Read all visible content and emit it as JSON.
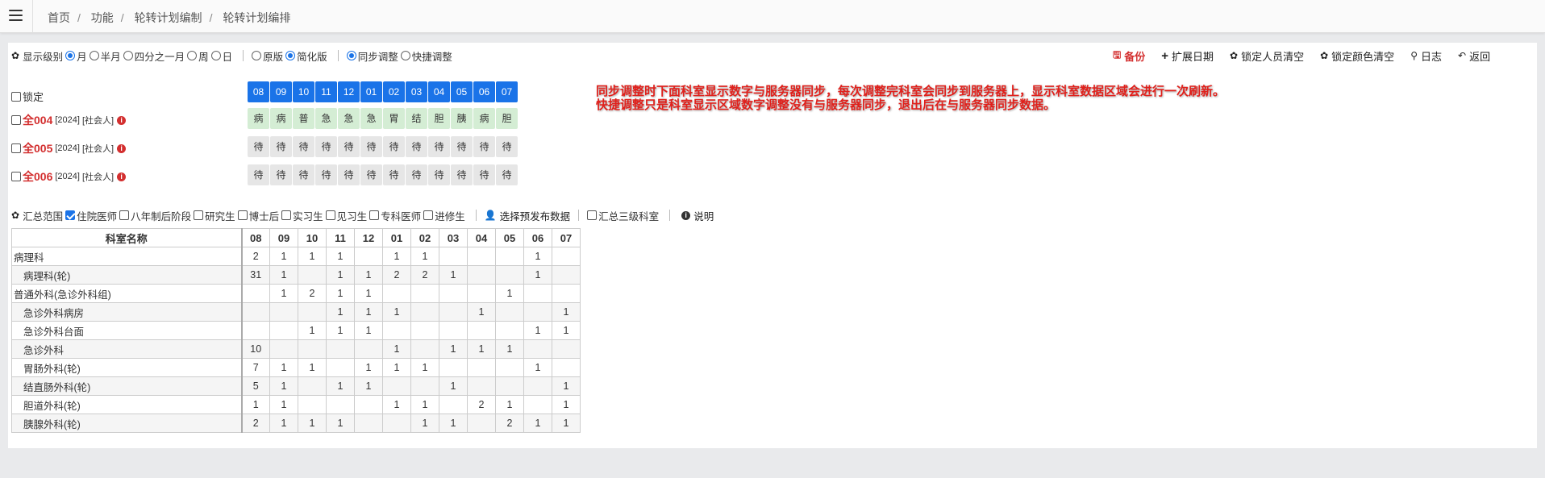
{
  "topbar": {
    "breadcrumb": [
      "首页",
      "功能",
      "轮转计划编制",
      "轮转计划编排"
    ]
  },
  "options": {
    "level_label": "显示级别",
    "levels": [
      {
        "label": "月",
        "checked": true
      },
      {
        "label": "半月",
        "checked": false
      },
      {
        "label": "四分之一月",
        "checked": false
      },
      {
        "label": "周",
        "checked": false
      },
      {
        "label": "日",
        "checked": false
      }
    ],
    "versions": [
      {
        "label": "原版",
        "checked": false
      },
      {
        "label": "简化版",
        "checked": true
      }
    ],
    "adjust": [
      {
        "label": "同步调整",
        "checked": true
      },
      {
        "label": "快捷调整",
        "checked": false
      }
    ]
  },
  "toolbar": {
    "backup": "备份",
    "extend_date": "扩展日期",
    "clear_people": "锁定人员清空",
    "clear_color": "锁定颜色清空",
    "log": "日志",
    "back": "返回"
  },
  "lock_label": "锁定",
  "months": [
    "08",
    "09",
    "10",
    "11",
    "12",
    "01",
    "02",
    "03",
    "04",
    "05",
    "06",
    "07"
  ],
  "people": [
    {
      "id": "全004",
      "year": "[2024]",
      "type": "[社会人]",
      "cells": [
        "病",
        "病",
        "普",
        "急",
        "急",
        "急",
        "胃",
        "结",
        "胆",
        "胰",
        "病",
        "胆"
      ],
      "style": "green"
    },
    {
      "id": "全005",
      "year": "[2024]",
      "type": "[社会人]",
      "cells": [
        "待",
        "待",
        "待",
        "待",
        "待",
        "待",
        "待",
        "待",
        "待",
        "待",
        "待",
        "待"
      ],
      "style": "gray"
    },
    {
      "id": "全006",
      "year": "[2024]",
      "type": "[社会人]",
      "cells": [
        "待",
        "待",
        "待",
        "待",
        "待",
        "待",
        "待",
        "待",
        "待",
        "待",
        "待",
        "待"
      ],
      "style": "gray"
    }
  ],
  "notice": {
    "line1": "同步调整时下面科室显示数字与服务器同步，每次调整完科室会同步到服务器上，显示科室数据区域会进行一次刷新。",
    "line2": "快捷调整只是科室显示区域数字调整没有与服务器同步，退出后在与服务器同步数据。"
  },
  "summary": {
    "range_label": "汇总范围",
    "filters": [
      {
        "label": "住院医师",
        "checked": true
      },
      {
        "label": "八年制后阶段",
        "checked": false
      },
      {
        "label": "研究生",
        "checked": false
      },
      {
        "label": "博士后",
        "checked": false
      },
      {
        "label": "实习生",
        "checked": false
      },
      {
        "label": "见习生",
        "checked": false
      },
      {
        "label": "专科医师",
        "checked": false
      },
      {
        "label": "进修生",
        "checked": false
      }
    ],
    "select_publish": "选择预发布数据",
    "level3": "汇总三级科室",
    "explain": "说明"
  },
  "table": {
    "header_name": "科室名称",
    "rows": [
      {
        "name": "病理科",
        "child": false,
        "values": [
          "2",
          "1",
          "1",
          "1",
          "",
          "1",
          "1",
          "",
          "",
          "",
          "1",
          ""
        ]
      },
      {
        "name": "病理科(轮)",
        "child": true,
        "values": [
          "31",
          "1",
          "",
          "1",
          "1",
          "2",
          "2",
          "1",
          "",
          "",
          "1",
          ""
        ]
      },
      {
        "name": "普通外科(急诊外科组)",
        "child": false,
        "values": [
          "",
          "1",
          "2",
          "1",
          "1",
          "",
          "",
          "",
          "",
          "1",
          "",
          ""
        ]
      },
      {
        "name": "急诊外科病房",
        "child": true,
        "values": [
          "",
          "",
          "",
          "1",
          "1",
          "1",
          "",
          "",
          "1",
          "",
          "",
          "1"
        ]
      },
      {
        "name": "急诊外科台面",
        "child": true,
        "values": [
          "",
          "",
          "1",
          "1",
          "1",
          "",
          "",
          "",
          "",
          "",
          "1",
          "1"
        ]
      },
      {
        "name": "急诊外科",
        "child": true,
        "values": [
          "10",
          "",
          "",
          "",
          "",
          "1",
          "",
          "1",
          "1",
          "1",
          "",
          ""
        ]
      },
      {
        "name": "胃肠外科(轮)",
        "child": true,
        "values": [
          "7",
          "1",
          "1",
          "",
          "1",
          "1",
          "1",
          "",
          "",
          "",
          "1",
          ""
        ]
      },
      {
        "name": "结直肠外科(轮)",
        "child": true,
        "values": [
          "5",
          "1",
          "",
          "1",
          "1",
          "",
          "",
          "1",
          "",
          "",
          "",
          "1"
        ]
      },
      {
        "name": "胆道外科(轮)",
        "child": true,
        "values": [
          "1",
          "1",
          "",
          "",
          "",
          "1",
          "1",
          "",
          "2",
          "1",
          "",
          "1"
        ]
      },
      {
        "name": "胰腺外科(轮)",
        "child": true,
        "values": [
          "2",
          "1",
          "1",
          "1",
          "",
          "",
          "1",
          "1",
          "",
          "2",
          "1",
          "1"
        ]
      }
    ]
  }
}
